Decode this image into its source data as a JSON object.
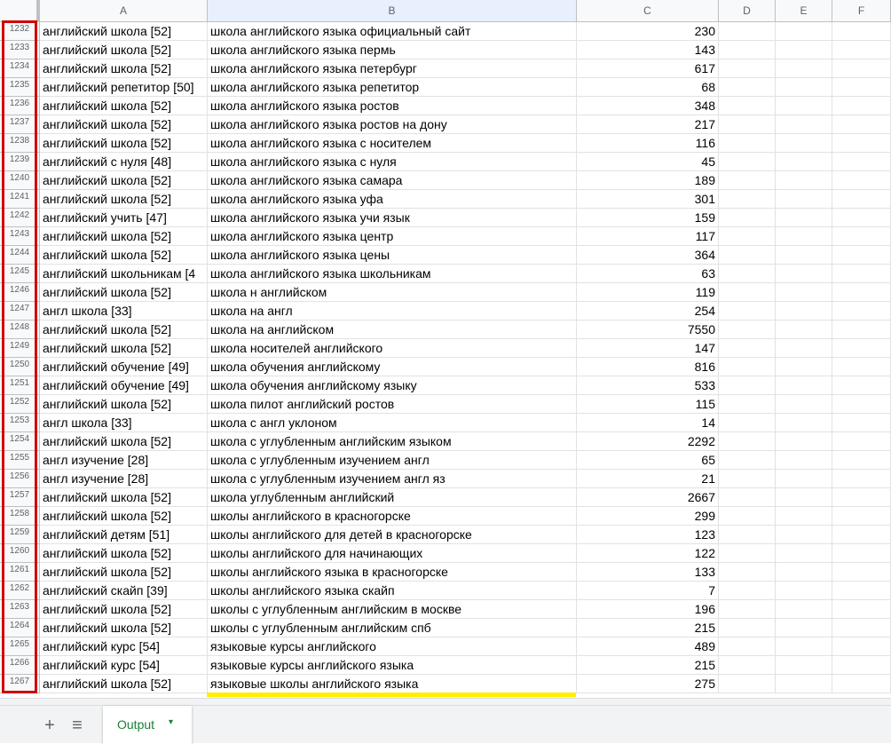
{
  "columns": [
    "A",
    "B",
    "C",
    "D",
    "E",
    "F"
  ],
  "rows": [
    {
      "n": "1232",
      "a": "английский школа [52]",
      "b": "школа английского языка официальный сайт",
      "c": "230"
    },
    {
      "n": "1233",
      "a": "английский школа [52]",
      "b": "школа английского языка пермь",
      "c": "143"
    },
    {
      "n": "1234",
      "a": "английский школа [52]",
      "b": "школа английского языка петербург",
      "c": "617"
    },
    {
      "n": "1235",
      "a": "английский репетитор [50]",
      "b": "школа английского языка репетитор",
      "c": "68"
    },
    {
      "n": "1236",
      "a": "английский школа [52]",
      "b": "школа английского языка ростов",
      "c": "348"
    },
    {
      "n": "1237",
      "a": "английский школа [52]",
      "b": "школа английского языка ростов на дону",
      "c": "217"
    },
    {
      "n": "1238",
      "a": "английский школа [52]",
      "b": "школа английского языка с носителем",
      "c": "116"
    },
    {
      "n": "1239",
      "a": "английский с нуля [48]",
      "b": "школа английского языка с нуля",
      "c": "45"
    },
    {
      "n": "1240",
      "a": "английский школа [52]",
      "b": "школа английского языка самара",
      "c": "189"
    },
    {
      "n": "1241",
      "a": "английский школа [52]",
      "b": "школа английского языка уфа",
      "c": "301"
    },
    {
      "n": "1242",
      "a": "английский учить [47]",
      "b": "школа английского языка учи язык",
      "c": "159"
    },
    {
      "n": "1243",
      "a": "английский школа [52]",
      "b": "школа английского языка центр",
      "c": "117"
    },
    {
      "n": "1244",
      "a": "английский школа [52]",
      "b": "школа английского языка цены",
      "c": "364"
    },
    {
      "n": "1245",
      "a": "английский школьникам [4",
      "b": "школа английского языка школьникам",
      "c": "63"
    },
    {
      "n": "1246",
      "a": "английский школа [52]",
      "b": "школа н английском",
      "c": "119"
    },
    {
      "n": "1247",
      "a": "англ школа [33]",
      "b": "школа на англ",
      "c": "254"
    },
    {
      "n": "1248",
      "a": "английский школа [52]",
      "b": "школа на английском",
      "c": "7550"
    },
    {
      "n": "1249",
      "a": "английский школа [52]",
      "b": "школа носителей английского",
      "c": "147"
    },
    {
      "n": "1250",
      "a": "английский обучение [49]",
      "b": "школа обучения английскому",
      "c": "816"
    },
    {
      "n": "1251",
      "a": "английский обучение [49]",
      "b": "школа обучения английскому языку",
      "c": "533"
    },
    {
      "n": "1252",
      "a": "английский школа [52]",
      "b": "школа пилот английский ростов",
      "c": "115"
    },
    {
      "n": "1253",
      "a": "англ школа [33]",
      "b": "школа с англ уклоном",
      "c": "14"
    },
    {
      "n": "1254",
      "a": "английский школа [52]",
      "b": "школа с углубленным английским языком",
      "c": "2292"
    },
    {
      "n": "1255",
      "a": "англ изучение [28]",
      "b": "школа с углубленным изучением англ",
      "c": "65"
    },
    {
      "n": "1256",
      "a": "англ изучение [28]",
      "b": "школа с углубленным изучением англ яз",
      "c": "21"
    },
    {
      "n": "1257",
      "a": "английский школа [52]",
      "b": "школа углубленным английский",
      "c": "2667"
    },
    {
      "n": "1258",
      "a": "английский школа [52]",
      "b": "школы английского в красногорске",
      "c": "299"
    },
    {
      "n": "1259",
      "a": "английский детям [51]",
      "b": "школы английского для детей в красногорске",
      "c": "123"
    },
    {
      "n": "1260",
      "a": "английский школа [52]",
      "b": "школы английского для начинающих",
      "c": "122"
    },
    {
      "n": "1261",
      "a": "английский школа [52]",
      "b": "школы английского языка в красногорске",
      "c": "133"
    },
    {
      "n": "1262",
      "a": "английский скайп [39]",
      "b": "школы английского языка скайп",
      "c": "7"
    },
    {
      "n": "1263",
      "a": "английский школа [52]",
      "b": "школы с углубленным английским в москве",
      "c": "196"
    },
    {
      "n": "1264",
      "a": "английский школа [52]",
      "b": "школы с углубленным английским спб",
      "c": "215"
    },
    {
      "n": "1265",
      "a": "английский курс [54]",
      "b": "языковые курсы английского",
      "c": "489"
    },
    {
      "n": "1266",
      "a": "английский курс [54]",
      "b": "языковые курсы английского языка",
      "c": "215"
    },
    {
      "n": "1267",
      "a": "английский школа [52]",
      "b": "языковые школы английского языка",
      "c": "275"
    }
  ],
  "tabbar": {
    "add_icon": "+",
    "list_icon": "≡",
    "sheet_name": "Output",
    "caret_icon": "▾"
  },
  "colors": {
    "highlight_box": "#d00000",
    "yellow_mark": "#ffef00",
    "tab_text": "#188038"
  }
}
